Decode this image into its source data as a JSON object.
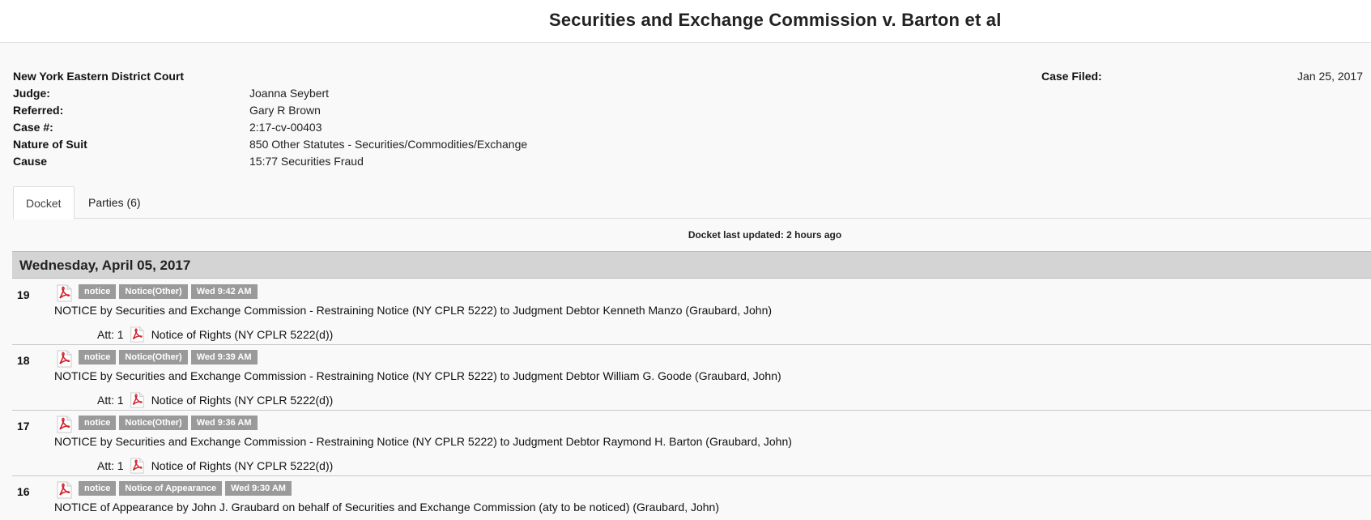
{
  "case": {
    "title": "Securities and Exchange Commission v. Barton et al",
    "court": "New York Eastern District Court",
    "fields": [
      {
        "label": "Judge:",
        "value": "Joanna Seybert"
      },
      {
        "label": "Referred:",
        "value": "Gary R Brown"
      },
      {
        "label": "Case #:",
        "value": "2:17-cv-00403"
      },
      {
        "label": "Nature of Suit",
        "value": "850 Other Statutes - Securities/Commodities/Exchange"
      },
      {
        "label": "Cause",
        "value": "15:77 Securities Fraud"
      }
    ],
    "filed_label": "Case Filed:",
    "filed_value": "Jan 25, 2017"
  },
  "tabs": [
    {
      "label": "Docket"
    },
    {
      "label": "Parties (6)"
    }
  ],
  "docket": {
    "last_updated": "Docket last updated: 2 hours ago",
    "day_header": "Wednesday, April 05, 2017",
    "entries": [
      {
        "number": "19",
        "tags": [
          "notice",
          "Notice(Other)",
          "Wed 9:42 AM"
        ],
        "description": "NOTICE by Securities and Exchange Commission - Restraining Notice (NY CPLR 5222) to Judgment Debtor Kenneth Manzo (Graubard, John)",
        "attachment": {
          "prefix": "Att: 1",
          "label": "Notice of Rights (NY CPLR 5222(d))"
        }
      },
      {
        "number": "18",
        "tags": [
          "notice",
          "Notice(Other)",
          "Wed 9:39 AM"
        ],
        "description": "NOTICE by Securities and Exchange Commission - Restraining Notice (NY CPLR 5222) to Judgment Debtor William G. Goode (Graubard, John)",
        "attachment": {
          "prefix": "Att: 1",
          "label": "Notice of Rights (NY CPLR 5222(d))"
        }
      },
      {
        "number": "17",
        "tags": [
          "notice",
          "Notice(Other)",
          "Wed 9:36 AM"
        ],
        "description": "NOTICE by Securities and Exchange Commission - Restraining Notice (NY CPLR 5222) to Judgment Debtor Raymond H. Barton (Graubard, John)",
        "attachment": {
          "prefix": "Att: 1",
          "label": "Notice of Rights (NY CPLR 5222(d))"
        }
      },
      {
        "number": "16",
        "tags": [
          "notice",
          "Notice of Appearance",
          "Wed 9:30 AM"
        ],
        "description": "NOTICE of Appearance by John J. Graubard on behalf of Securities and Exchange Commission (aty to be noticed) (Graubard, John)"
      }
    ]
  },
  "icons": {
    "document": "pdf-icon"
  },
  "colors": {
    "tag": "#9a9a9a",
    "day_header": "#d4d4d4",
    "pdf_red": "#d2232a"
  }
}
